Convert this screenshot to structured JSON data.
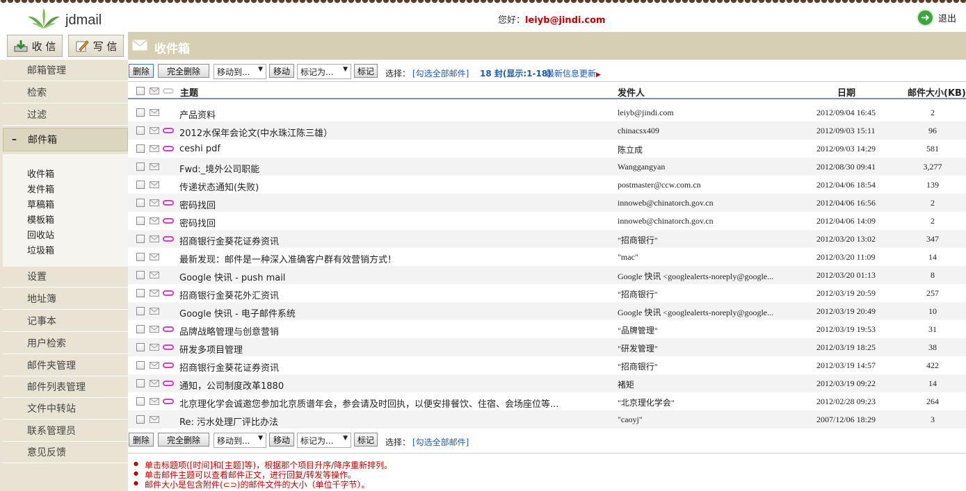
{
  "app": {
    "brand": "jdmail",
    "greeting_label": "您好：",
    "user_email": "leiyb@jindi.com",
    "logout_label": "退出"
  },
  "side_buttons": {
    "receive": "收 信",
    "compose": "写 信"
  },
  "folder_title": "收件箱",
  "nav": {
    "top_items": [
      "邮箱管理",
      "检索",
      "过滤",
      "邮件箱"
    ],
    "active": "邮件箱",
    "sub_items": [
      "收件箱",
      "发件箱",
      "草稿箱",
      "模板箱",
      "回收站",
      "垃圾箱"
    ],
    "bottom_items": [
      "设置",
      "地址簿",
      "记事本",
      "用户检索",
      "邮件夹管理",
      "邮件列表管理",
      "文件中转站",
      "联系管理员",
      "意见反馈"
    ]
  },
  "toolbar": {
    "delete": "删除",
    "delete_perm": "完全删除",
    "move_select": "移动到...",
    "move": "移动",
    "mark_select": "标记为...",
    "mark": "标记",
    "select_label": "选择：",
    "select_all": "[勾选全部邮件]",
    "count": "18 封(显示:1-18)",
    "refresh": "最新信息更新"
  },
  "columns": {
    "subject": "主题",
    "sender": "发件人",
    "date": "日期",
    "size": "邮件大小(KB)"
  },
  "emails": [
    {
      "subject": "产品资料",
      "sender": "leiyb@jindi.com",
      "date": "2012/09/04 16:45",
      "size": "2",
      "attach": false
    },
    {
      "subject": "2012水保年会论文(中水珠江陈三雄）",
      "sender": "chinacsx409",
      "date": "2012/09/03 15:11",
      "size": "96",
      "attach": true
    },
    {
      "subject": "ceshi pdf",
      "sender": "陈立成",
      "date": "2012/09/03 14:29",
      "size": "581",
      "attach": true
    },
    {
      "subject": "Fwd:_境外公司职能",
      "sender": "Wanggangyan",
      "date": "2012/08/30 09:41",
      "size": "3,277",
      "attach": false
    },
    {
      "subject": "传递状态通知(失败)",
      "sender": "postmaster@ccw.com.cn",
      "date": "2012/04/06 18:54",
      "size": "139",
      "attach": false
    },
    {
      "subject": "密码找回",
      "sender": "innoweb@chinatorch.gov.cn",
      "date": "2012/04/06 16:56",
      "size": "2",
      "attach": true
    },
    {
      "subject": "密码找回",
      "sender": "innoweb@chinatorch.gov.cn",
      "date": "2012/04/06 14:09",
      "size": "2",
      "attach": true
    },
    {
      "subject": "招商银行金葵花证券资讯",
      "sender": "\"招商银行\"",
      "date": "2012/03/20 13:02",
      "size": "347",
      "attach": true
    },
    {
      "subject": "最新发现：邮件是一种深入准确客户群有效营销方式！",
      "sender": "\"mac\"",
      "date": "2012/03/20 11:09",
      "size": "14",
      "attach": false
    },
    {
      "subject": "Google 快讯 - push mail",
      "sender": "Google 快讯 <googlealerts-noreply@google...",
      "date": "2012/03/20 01:13",
      "size": "8",
      "attach": false
    },
    {
      "subject": "招商银行金葵花外汇资讯",
      "sender": "\"招商银行\"",
      "date": "2012/03/19 20:59",
      "size": "257",
      "attach": true
    },
    {
      "subject": "Google 快讯 - 电子邮件系统",
      "sender": "Google 快讯 <googlealerts-noreply@google...",
      "date": "2012/03/19 20:49",
      "size": "10",
      "attach": false
    },
    {
      "subject": "品牌战略管理与创意营销",
      "sender": "\"品牌管理\"",
      "date": "2012/03/19 19:53",
      "size": "31",
      "attach": true
    },
    {
      "subject": "研发多项目管理",
      "sender": "\"研发管理\"",
      "date": "2012/03/19 18:25",
      "size": "38",
      "attach": true
    },
    {
      "subject": "招商银行金葵花证券资讯",
      "sender": "\"招商银行\"",
      "date": "2012/03/19 14:57",
      "size": "422",
      "attach": true
    },
    {
      "subject": "通知，公司制度改革1880",
      "sender": "褚矩",
      "date": "2012/03/19 09:22",
      "size": "14",
      "attach": true
    },
    {
      "subject": "北京理化学会诚邀您参加北京质谱年会，参会请及时回执，以便安排餐饮、住宿、会场座位等...",
      "sender": "\"北京理化学会\"",
      "date": "2012/02/28 09:23",
      "size": "264",
      "attach": true
    },
    {
      "subject": "Re: 污水处理厂评比办法",
      "sender": "\"caoyj\"",
      "date": "2007/12/06 18:29",
      "size": "3",
      "attach": false
    }
  ],
  "notes": [
    "单击标题项([时间]和[主题]等)，根据那个项目升序/降序重新排列。",
    "单击邮件主题可以查看邮件正文，进行回复/转发等操作。",
    "邮件大小是包含附件(⊂⊃)的邮件文件的大小（单位千字节）。"
  ],
  "colors": {
    "accent_red": "#c00000",
    "link_blue": "#1f5aa6",
    "header_band": "#d6cfb3",
    "sidebar": "#e8e3d3"
  }
}
